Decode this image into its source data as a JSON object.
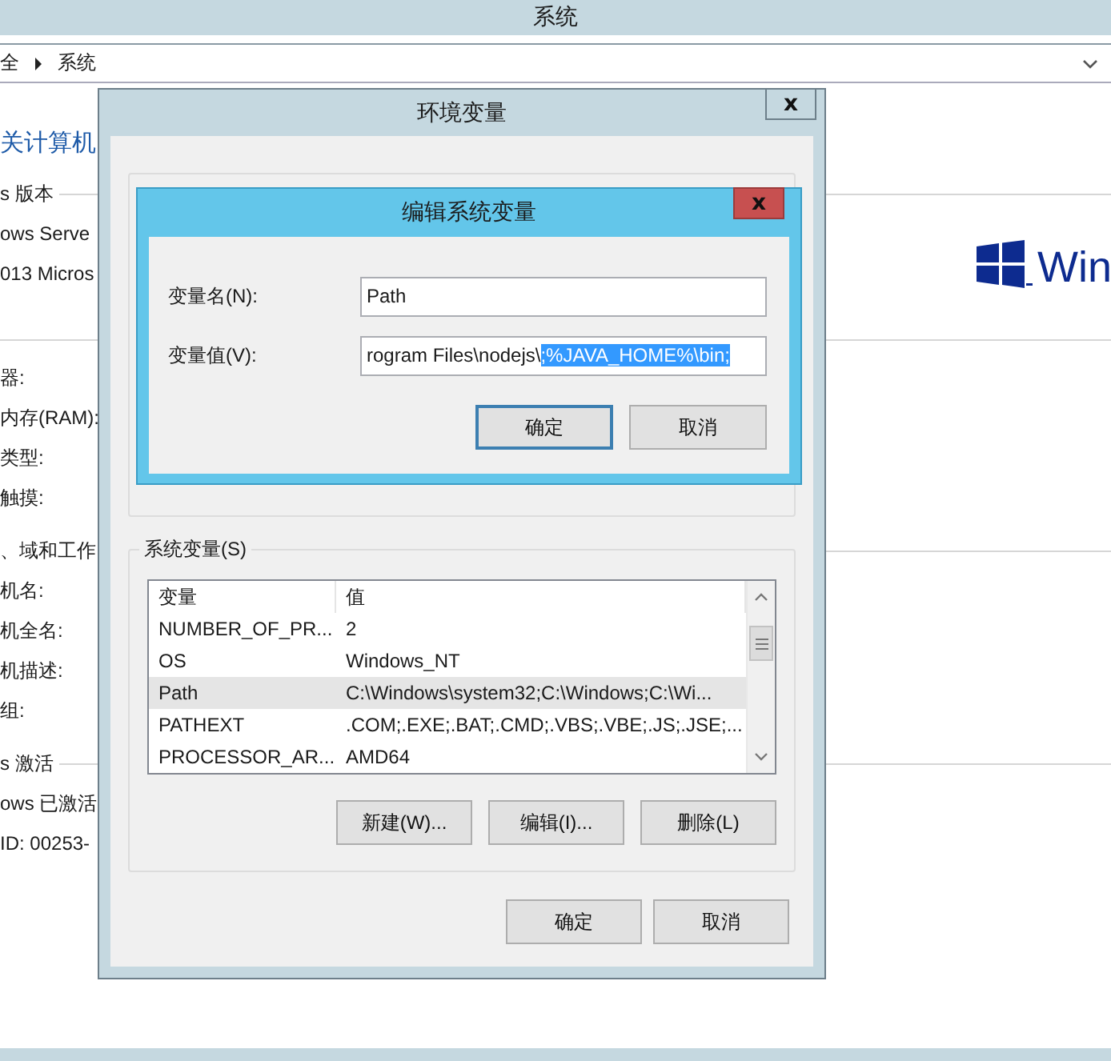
{
  "system_window": {
    "title": "系统",
    "breadcrumb": [
      {
        "label": "全"
      },
      {
        "label": "系统"
      }
    ],
    "heading": "关计算机",
    "groups": [
      {
        "title": "s 版本",
        "lines": [
          "ows Serve",
          "013 Micros"
        ]
      },
      {
        "lines": [
          "器:",
          "内存(RAM):",
          "类型:",
          "触摸:"
        ]
      },
      {
        "title": "、域和工作",
        "lines": [
          "机名:",
          "机全名:",
          "机描述:",
          "组:"
        ]
      },
      {
        "title": "s 激活",
        "lines": [
          "ows 已激活",
          "ID: 00253-"
        ]
      }
    ],
    "logo_text": "Win"
  },
  "environment_dialog": {
    "title": "环境变量",
    "close": "x",
    "system_variables": {
      "label": "系统变量(S)",
      "columns": [
        "变量",
        "值"
      ],
      "rows": [
        {
          "name": "NUMBER_OF_PR...",
          "value": "2",
          "selected": false
        },
        {
          "name": "OS",
          "value": "Windows_NT",
          "selected": false
        },
        {
          "name": "Path",
          "value": "C:\\Windows\\system32;C:\\Windows;C:\\Wi...",
          "selected": true
        },
        {
          "name": "PATHEXT",
          "value": ".COM;.EXE;.BAT;.CMD;.VBS;.VBE;.JS;.JSE;...",
          "selected": false
        },
        {
          "name": "PROCESSOR_AR...",
          "value": "AMD64",
          "selected": false
        }
      ],
      "buttons": [
        "新建(W)...",
        "编辑(I)...",
        "删除(L)"
      ]
    },
    "buttons": [
      {
        "label": "确定",
        "focused": false
      },
      {
        "label": "取消",
        "focused": false
      }
    ]
  },
  "edit_dialog": {
    "title": "编辑系统变量",
    "close": "x",
    "fields": [
      {
        "label": "变量名(N):",
        "value": "Path"
      },
      {
        "label": "变量值(V):",
        "value": "rogram Files\\nodejs\\",
        "selected_text": ";%JAVA_HOME%\\bin;"
      }
    ],
    "buttons": [
      {
        "label": "确定",
        "focused": true
      },
      {
        "label": "取消",
        "focused": false
      }
    ]
  }
}
